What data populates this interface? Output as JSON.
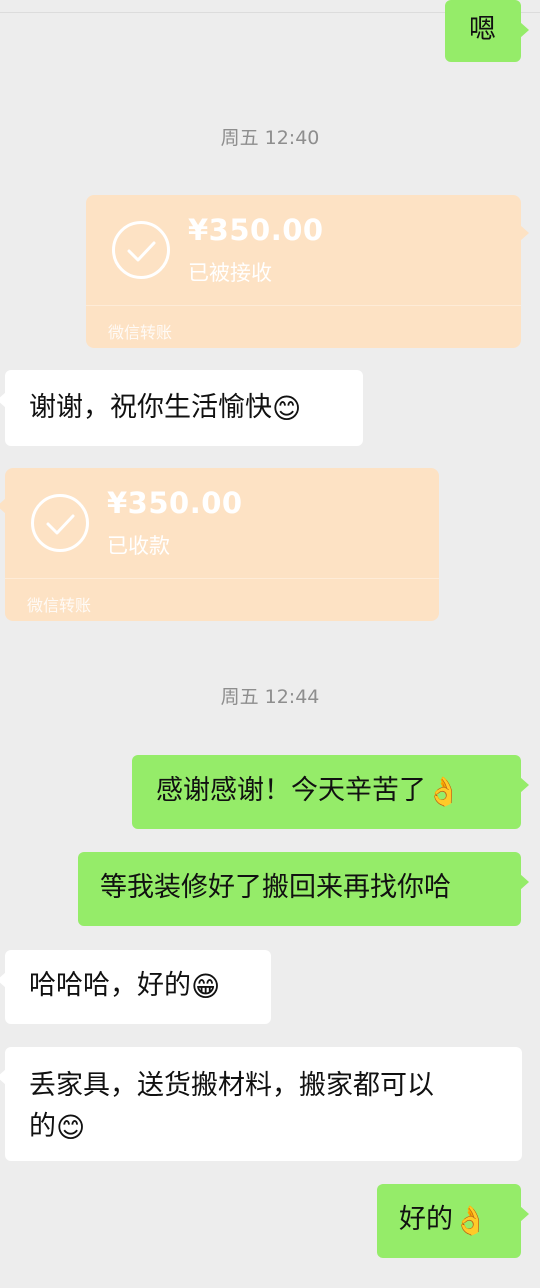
{
  "messages": {
    "m0_text": "嗯",
    "ts1": "周五 12:40",
    "transfer1": {
      "amount": "¥350.00",
      "status": "已被接收",
      "label": "微信转账"
    },
    "m1_text": "谢谢，祝你生活愉快",
    "m1_emoji": "😊",
    "transfer2": {
      "amount": "¥350.00",
      "status": "已收款",
      "label": "微信转账"
    },
    "ts2": "周五 12:44",
    "m2_text": "感谢感谢！今天辛苦了",
    "m2_emoji": "👌",
    "m3_text": "等我装修好了搬回来再找你哈",
    "m4_text": "哈哈哈，好的",
    "m4_emoji": "😁",
    "m5_line1": "丢家具，送货搬材料，搬家都可以",
    "m5_line2": "的",
    "m5_emoji": "😊",
    "m6_text": "好的",
    "m6_emoji": "👌"
  },
  "colors": {
    "background": "#ededed",
    "my_bubble": "#95ec69",
    "other_bubble": "#ffffff",
    "transfer_card": "#fde2c4"
  },
  "icons": {
    "transfer_check": "check-circle-icon"
  }
}
